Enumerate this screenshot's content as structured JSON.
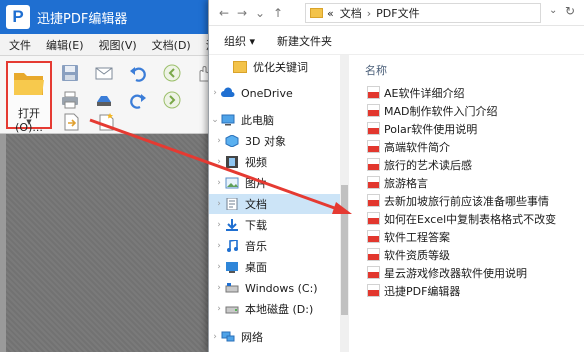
{
  "app": {
    "logo_letter": "P",
    "title": "迅捷PDF编辑器",
    "menus": [
      "文件",
      "编辑(E)",
      "视图(V)",
      "文档(D)",
      "注"
    ],
    "open_button": "打开(O)..."
  },
  "explorer": {
    "nav_back": "←",
    "nav_forward": "→",
    "nav_down": "⌄",
    "nav_up": "↑",
    "address": {
      "prefix": "«",
      "crumb1": "文档",
      "crumb2": "PDF文件"
    },
    "commands": {
      "organize": "组织 ▾",
      "new_folder": "新建文件夹"
    },
    "nav_items": [
      {
        "label": "优化关键词"
      },
      {
        "label": "OneDrive"
      },
      {
        "label": "此电脑"
      },
      {
        "label": "3D 对象"
      },
      {
        "label": "视频"
      },
      {
        "label": "图片"
      },
      {
        "label": "文档"
      },
      {
        "label": "下载"
      },
      {
        "label": "音乐"
      },
      {
        "label": "桌面"
      },
      {
        "label": "Windows (C:)"
      },
      {
        "label": "本地磁盘 (D:)"
      },
      {
        "label": "网络"
      }
    ],
    "column_header": "名称",
    "files": [
      "AE软件详细介绍",
      "MAD制作软件入门介绍",
      "Polar软件使用说明",
      "高端软件简介",
      "旅行的艺术读后感",
      "旅游格言",
      "去新加坡旅行前应该准备哪些事情",
      "如何在Excel中复制表格格式不改变",
      "软件工程答案",
      "软件资质等级",
      "星云游戏修改器软件使用说明",
      "迅捷PDF编辑器"
    ]
  },
  "colors": {
    "accent_blue": "#1f6fd1",
    "highlight_red": "#e53a32",
    "selection": "#cce4f7",
    "pdf_red": "#e2372e"
  }
}
